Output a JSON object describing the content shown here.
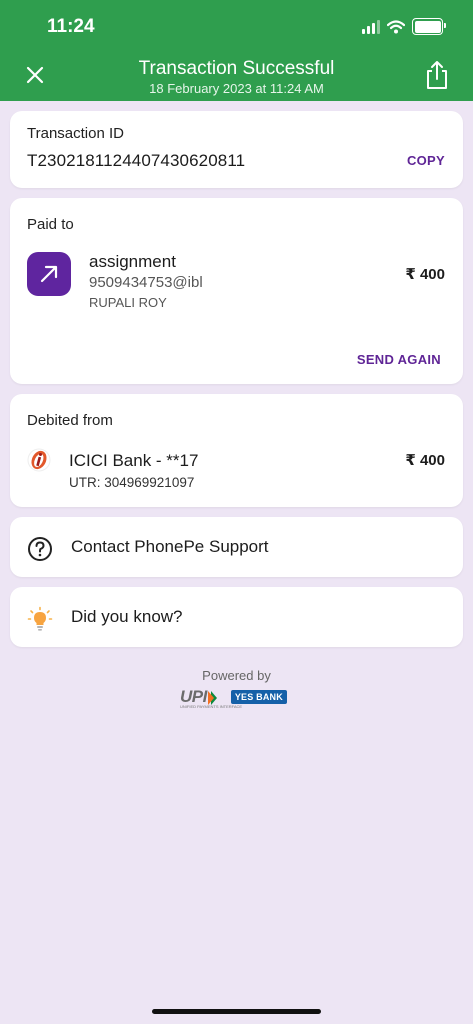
{
  "status_bar": {
    "time": "11:24"
  },
  "header": {
    "title": "Transaction Successful",
    "subtitle": "18 February 2023 at 11:24 AM",
    "close_icon": "close-icon",
    "share_icon": "share-icon"
  },
  "transaction": {
    "label": "Transaction ID",
    "id": "T2302181124407430620811",
    "copy_label": "COPY"
  },
  "paid_to": {
    "label": "Paid to",
    "name": "assignment",
    "upi_id": "9509434753@ibl",
    "real_name": "RUPALI ROY",
    "amount": "₹ 400",
    "send_again_label": "SEND AGAIN"
  },
  "debited_from": {
    "label": "Debited from",
    "bank": "ICICI Bank - **17",
    "utr": "UTR: 304969921097",
    "amount": "₹ 400"
  },
  "support": {
    "label": "Contact PhonePe Support"
  },
  "did_you_know": {
    "label": "Did you know?"
  },
  "footer": {
    "powered_by": "Powered by",
    "upi_logo_text": "UPI",
    "upi_logo_subtext": "UNIFIED PAYMENTS INTERFACE",
    "yes_bank_text": "YES BANK"
  },
  "colors": {
    "header_green": "#2f9e4e",
    "accent_purple": "#5f2596",
    "background": "#ede5f4"
  }
}
